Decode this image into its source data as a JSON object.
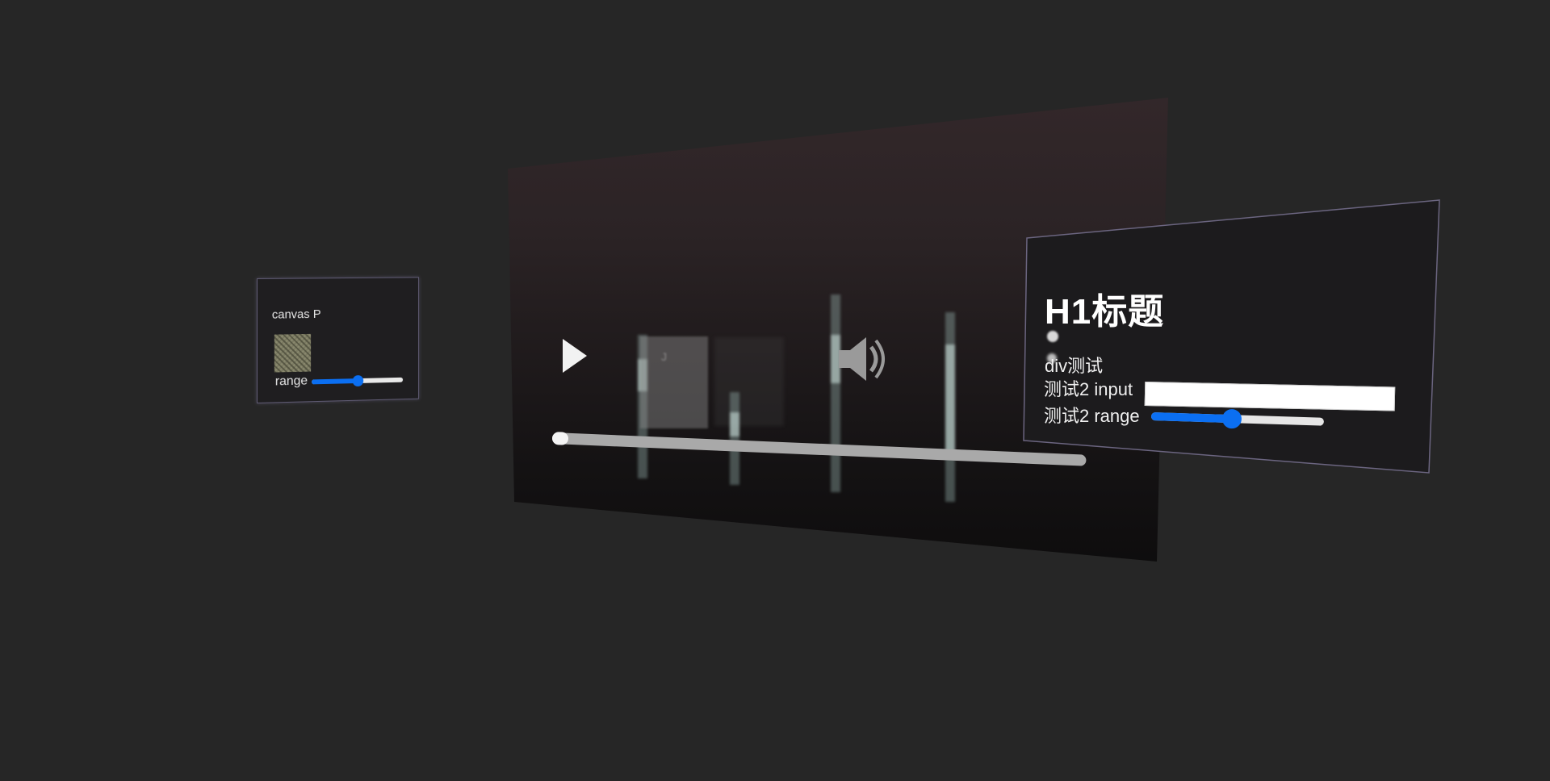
{
  "left_panel": {
    "title": "canvas P",
    "range_label": "range",
    "range_value": 0.5
  },
  "video": {
    "play_icon": "play-icon",
    "volume_icon": "volume-icon",
    "ghost_text": "J",
    "progress_value": 0
  },
  "right_panel": {
    "heading": "H1标题",
    "div_text": "div测试",
    "input_label": "测试2 input",
    "input_value": "",
    "range_label": "测试2 range",
    "range_value": 0.47
  },
  "colors": {
    "background": "#262626",
    "accent": "#0b6ff2",
    "panel": "#1c1b1d"
  }
}
